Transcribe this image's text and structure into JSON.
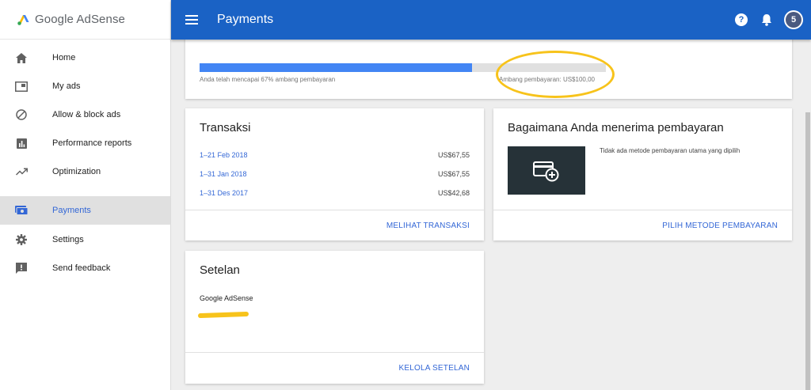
{
  "app": {
    "brand": "Google AdSense",
    "title": "Payments"
  },
  "header": {
    "help_glyph": "?",
    "avatar_initial": "5"
  },
  "sidebar": {
    "items": [
      {
        "label": "Home",
        "icon": "home-icon"
      },
      {
        "label": "My ads",
        "icon": "ads-icon"
      },
      {
        "label": "Allow & block ads",
        "icon": "block-icon"
      },
      {
        "label": "Performance reports",
        "icon": "reports-icon"
      },
      {
        "label": "Optimization",
        "icon": "trending-icon"
      },
      {
        "label": "Payments",
        "icon": "payments-icon",
        "active": true
      },
      {
        "label": "Settings",
        "icon": "gear-icon"
      },
      {
        "label": "Send feedback",
        "icon": "feedback-icon"
      }
    ]
  },
  "threshold": {
    "progress_percent": 67,
    "caption": "Anda telah mencapai 67% ambang pembayaran",
    "threshold_label": "Ambang pembayaran: US$100,00"
  },
  "transactions": {
    "title": "Transaksi",
    "rows": [
      {
        "period": "1–21 Feb 2018",
        "amount": "US$67,55"
      },
      {
        "period": "1–31 Jan 2018",
        "amount": "US$67,55"
      },
      {
        "period": "1–31 Des 2017",
        "amount": "US$42,68"
      }
    ],
    "action": "MELIHAT TRANSAKSI"
  },
  "payment_method": {
    "title": "Bagaimana Anda menerima pembayaran",
    "note": "Tidak ada metode pembayaran utama yang dipilih",
    "action": "PILIH METODE PEMBAYARAN"
  },
  "settings": {
    "title": "Setelan",
    "account_name": "Google AdSense",
    "action": "KELOLA SETELAN"
  },
  "colors": {
    "header": "#1a62c5",
    "accent": "#3367d6",
    "progress": "#4285f4",
    "highlight": "#f7c31b"
  }
}
